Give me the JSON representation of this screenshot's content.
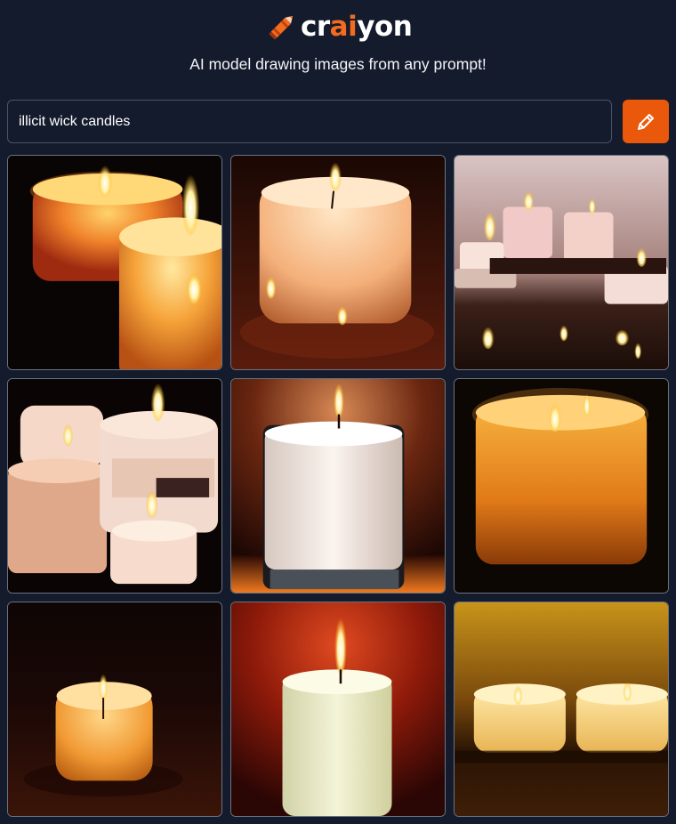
{
  "header": {
    "logo_parts": [
      "cr",
      "ai",
      "yon"
    ],
    "tagline": "AI model drawing images from any prompt!",
    "accent_color": "#f26b1f"
  },
  "search": {
    "value": "illicit wick candles",
    "button_icon": "pencil-icon",
    "button_color": "#ea580c"
  },
  "results": {
    "count": 9,
    "subject": "candles"
  }
}
